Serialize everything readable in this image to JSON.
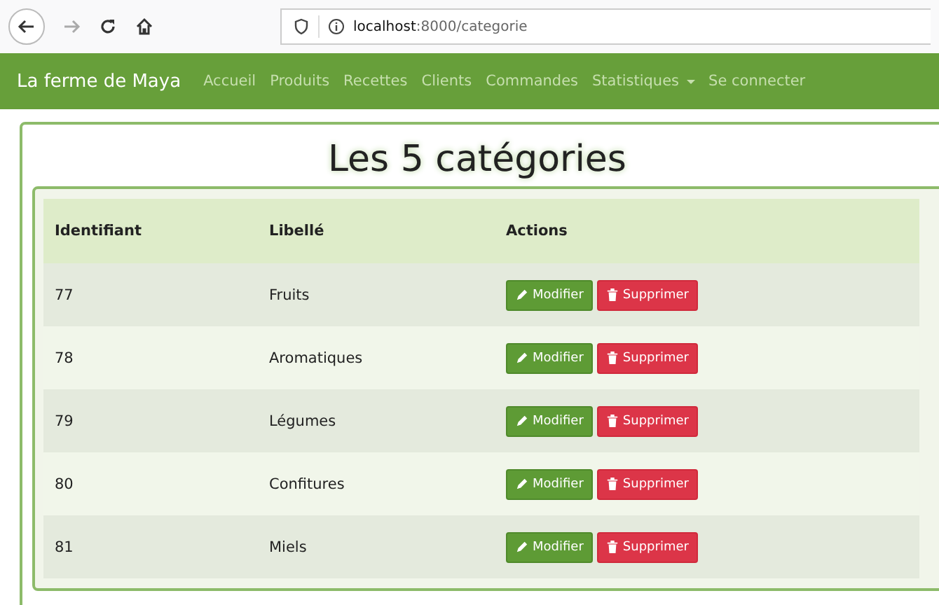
{
  "browser": {
    "url_host": "localhost",
    "url_path": ":8000/categorie"
  },
  "navbar": {
    "brand": "La ferme de Maya",
    "links": [
      {
        "label": "Accueil",
        "dropdown": false
      },
      {
        "label": "Produits",
        "dropdown": false
      },
      {
        "label": "Recettes",
        "dropdown": false
      },
      {
        "label": "Clients",
        "dropdown": false
      },
      {
        "label": "Commandes",
        "dropdown": false
      },
      {
        "label": "Statistiques",
        "dropdown": true
      },
      {
        "label": "Se connecter",
        "dropdown": false
      }
    ]
  },
  "heading": "Les 5 catégories",
  "table": {
    "columns": [
      "Identifiant",
      "Libellé",
      "Actions"
    ],
    "rows": [
      {
        "id": "77",
        "label": "Fruits",
        "edit": "Modifier",
        "delete": "Supprimer"
      },
      {
        "id": "78",
        "label": "Aromatiques",
        "edit": "Modifier",
        "delete": "Supprimer"
      },
      {
        "id": "79",
        "label": "Légumes",
        "edit": "Modifier",
        "delete": "Supprimer"
      },
      {
        "id": "80",
        "label": "Confitures",
        "edit": "Modifier",
        "delete": "Supprimer"
      },
      {
        "id": "81",
        "label": "Miels",
        "edit": "Modifier",
        "delete": "Supprimer"
      }
    ]
  }
}
